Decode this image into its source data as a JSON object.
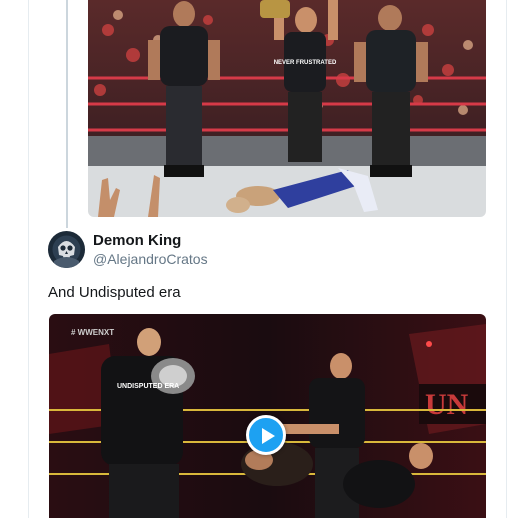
{
  "quoted_tweet": {
    "media_alt": "Photo of wrestlers in a ring",
    "shirt_text": "NEVER FRUSTRATED"
  },
  "tweet": {
    "display_name": "Demon King",
    "handle": "@AlejandroCratos",
    "text": "And Undisputed era",
    "video": {
      "watermark": "# WWENXT",
      "sign_text": "UN",
      "shirt_text": "UNDISPUTED ERA"
    }
  },
  "colors": {
    "play_button": "#1da1f2",
    "handle_gray": "#657786",
    "border": "#e6ecf0"
  },
  "icons": {
    "play": "play-icon",
    "avatar": "skull-avatar"
  }
}
